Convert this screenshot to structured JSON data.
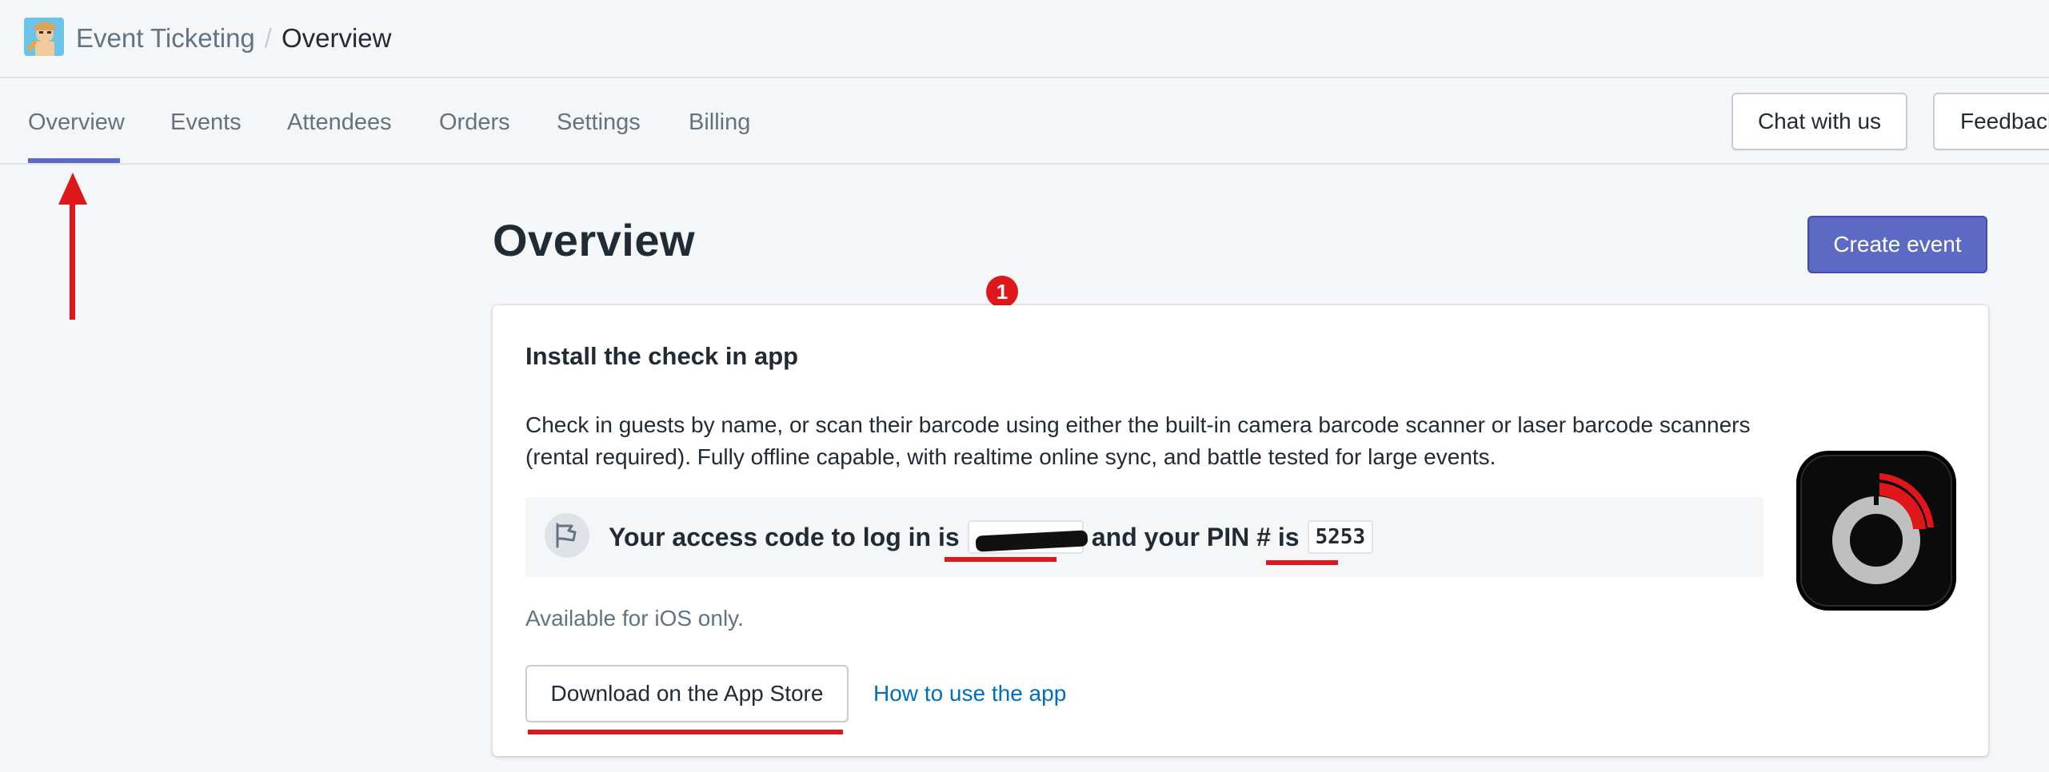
{
  "header": {
    "app_name": "Event Ticketing",
    "separator": "/",
    "current_page": "Overview"
  },
  "nav": {
    "tabs": [
      {
        "label": "Overview",
        "active": true
      },
      {
        "label": "Events"
      },
      {
        "label": "Attendees"
      },
      {
        "label": "Orders"
      },
      {
        "label": "Settings"
      },
      {
        "label": "Billing"
      }
    ],
    "chat_label": "Chat with us",
    "feedback_label": "Feedback"
  },
  "page": {
    "title": "Overview",
    "create_event_label": "Create event"
  },
  "annotation": {
    "step_badge": "1"
  },
  "card": {
    "title": "Install the check in app",
    "description": "Check in guests by name, or scan their barcode using either the built-in camera barcode scanner or laser barcode scanners (rental required). Fully offline capable, with realtime online sync, and battle tested for large events.",
    "access_prefix": "Your access code to log in is",
    "access_code_redacted": "xxxxxxxx",
    "access_middle": "and your PIN # is",
    "pin": "5253",
    "ios_note": "Available for iOS only.",
    "download_label": "Download on the App Store",
    "howto_label": "How to use the app"
  },
  "colors": {
    "primary": "#5c6ac4",
    "annotation_red": "#e0171a",
    "link": "#006fbb"
  },
  "icons": [
    "app-logo-icon",
    "flag-icon",
    "check-in-app-icon"
  ]
}
